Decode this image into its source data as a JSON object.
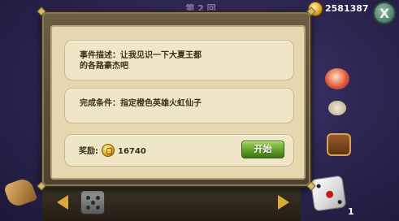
{
  "hud": {
    "round_label": "第 2 回",
    "coin_count": "2581387",
    "close_label": "X",
    "dice_count": "1"
  },
  "dialog": {
    "event_line1": "事件描述：让我见识一下大夏王都",
    "event_line2": "的各路豪杰吧",
    "condition": "完成条件：指定橙色英雄火虹仙子",
    "reward_label": "奖励:",
    "reward_value": "16740",
    "start_label": "开始"
  },
  "icons": [
    "coin-icon",
    "dice-icon",
    "arrow-left-icon",
    "arrow-right-icon",
    "close-icon"
  ],
  "colors": {
    "accent_green": "#5e9d26",
    "panel_bg": "#efe6c7",
    "frame_brown": "#4c4230",
    "coin_gold": "#e0a21e"
  }
}
